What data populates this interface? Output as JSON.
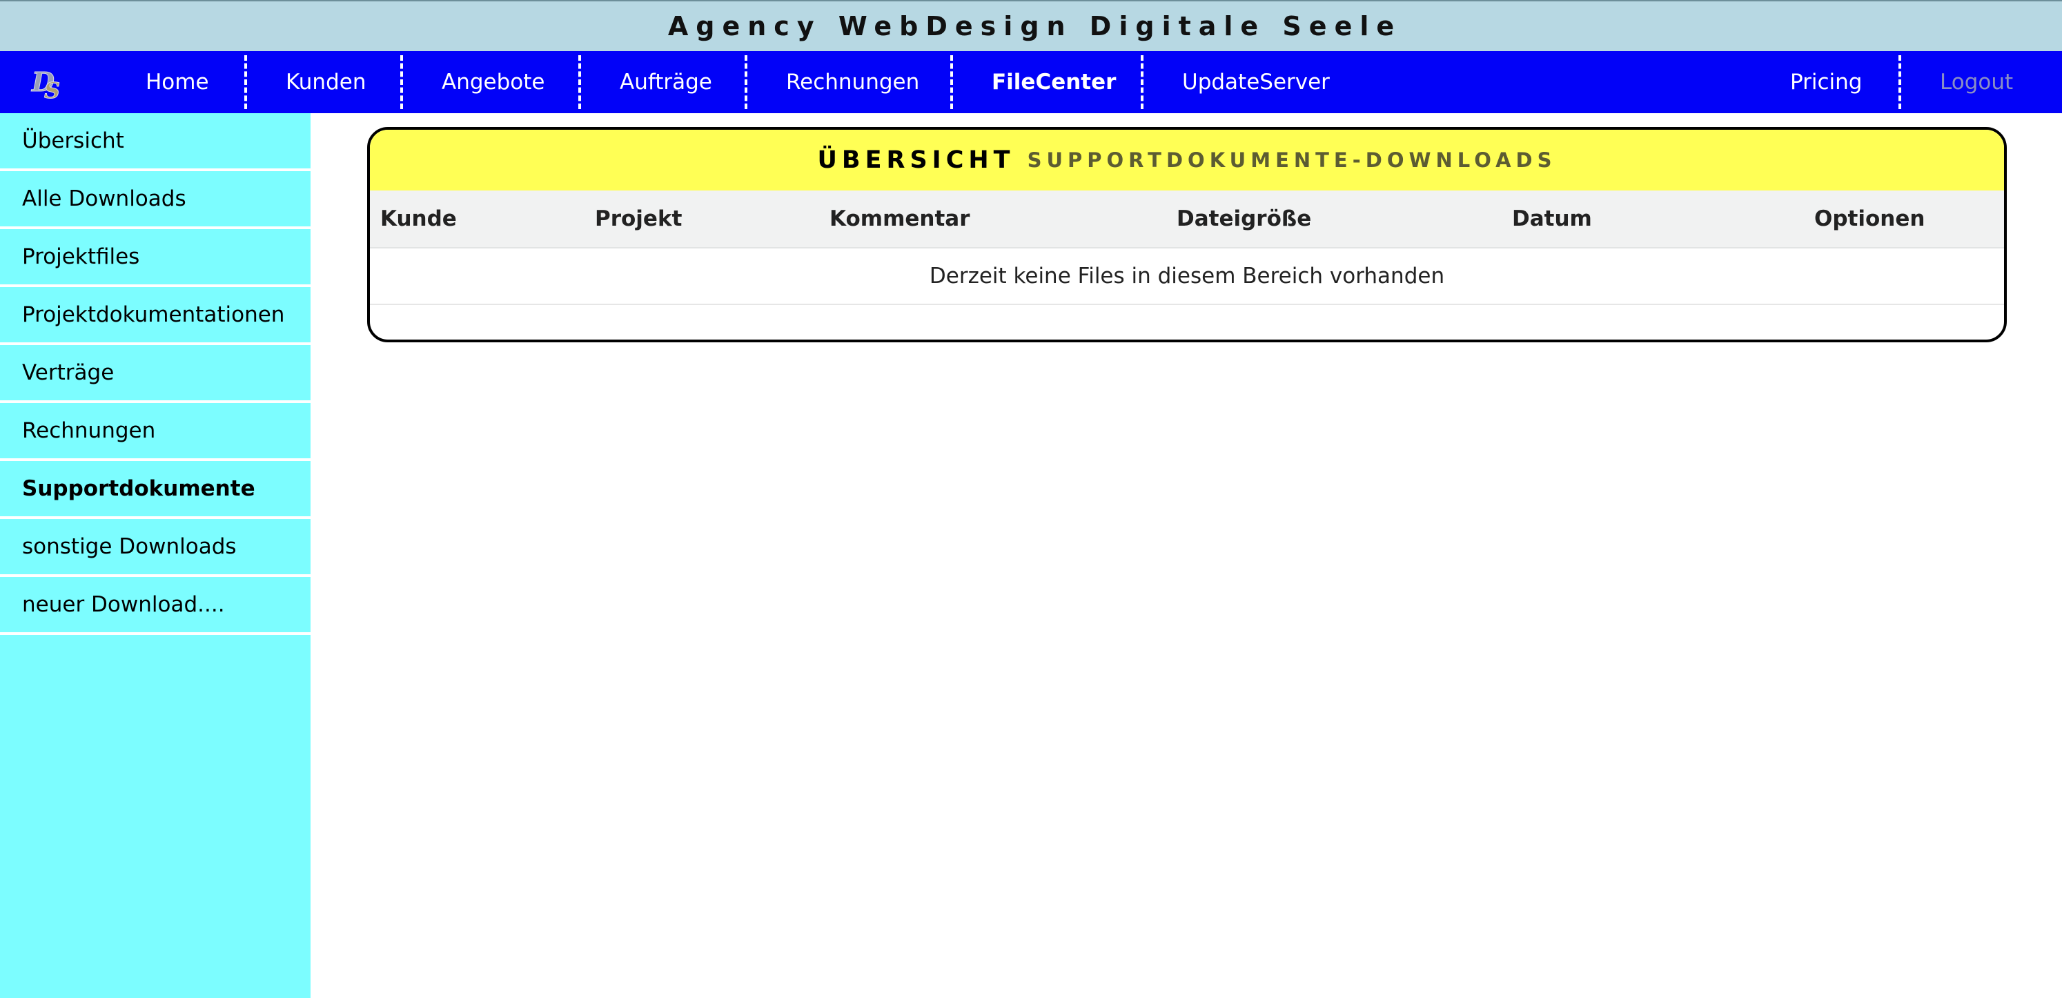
{
  "app": {
    "title": "Agency WebDesign Digitale Seele"
  },
  "nav": {
    "logo_text": "DS",
    "items": [
      {
        "label": "Home"
      },
      {
        "label": "Kunden"
      },
      {
        "label": "Angebote"
      },
      {
        "label": "Aufträge"
      },
      {
        "label": "Rechnungen"
      },
      {
        "label": "FileCenter",
        "active": true
      },
      {
        "label": "UpdateServer"
      }
    ],
    "right_items": [
      {
        "label": "Pricing"
      },
      {
        "label": "Logout",
        "muted": true
      }
    ]
  },
  "sidebar": {
    "items": [
      {
        "label": "Übersicht"
      },
      {
        "label": "Alle Downloads"
      },
      {
        "label": "Projektfiles"
      },
      {
        "label": "Projektdokumentationen"
      },
      {
        "label": "Verträge"
      },
      {
        "label": "Rechnungen"
      },
      {
        "label": "Supportdokumente",
        "active": true
      },
      {
        "label": "sonstige Downloads"
      },
      {
        "label": "neuer Download...."
      }
    ]
  },
  "panel": {
    "title_main": "ÜBERSICHT",
    "title_sub": "SUPPORTDOKUMENTE-DOWNLOADS",
    "columns": [
      "Kunde",
      "Projekt",
      "Kommentar",
      "Dateigröße",
      "Datum",
      "Optionen"
    ],
    "empty_message": "Derzeit keine Files in diesem Bereich vorhanden"
  },
  "colors": {
    "titlebar_bg": "#b7d8e3",
    "nav_bg": "#0202f8",
    "sidebar_bg": "#7cfdff",
    "panel_header_bg": "#ffff55"
  }
}
